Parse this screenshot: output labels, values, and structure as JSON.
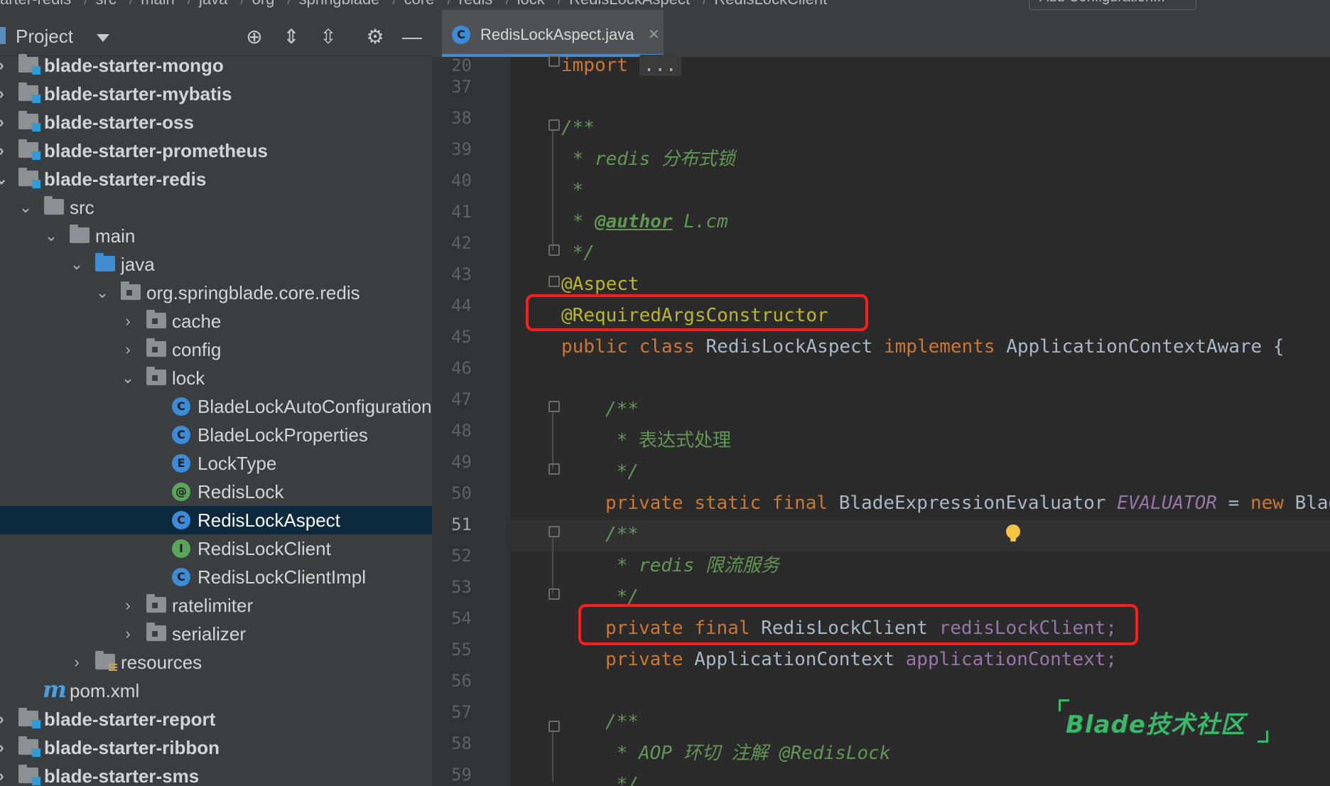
{
  "breadcrumb": [
    "arter-redis",
    "src",
    "main",
    "java",
    "org",
    "springblade",
    "core",
    "redis",
    "lock",
    "RedisLockAspect",
    "RedisLockClient"
  ],
  "toolbar": {
    "add_config": "Add Configuration..."
  },
  "project": {
    "title": "Project",
    "tree": [
      {
        "label": "blade-starter-mongo",
        "bold": true
      },
      {
        "label": "blade-starter-mybatis",
        "bold": true
      },
      {
        "label": "blade-starter-oss",
        "bold": true
      },
      {
        "label": "blade-starter-prometheus",
        "bold": true
      },
      {
        "label": "blade-starter-redis",
        "bold": true
      },
      {
        "label": "src"
      },
      {
        "label": "main"
      },
      {
        "label": "java"
      },
      {
        "label": "org.springblade.core.redis"
      },
      {
        "label": "cache"
      },
      {
        "label": "config"
      },
      {
        "label": "lock"
      },
      {
        "label": "BladeLockAutoConfiguration",
        "icon": "C"
      },
      {
        "label": "BladeLockProperties",
        "icon": "C"
      },
      {
        "label": "LockType",
        "icon": "E"
      },
      {
        "label": "RedisLock",
        "icon": "@"
      },
      {
        "label": "RedisLockAspect",
        "icon": "C",
        "selected": true
      },
      {
        "label": "RedisLockClient",
        "icon": "I"
      },
      {
        "label": "RedisLockClientImpl",
        "icon": "C"
      },
      {
        "label": "ratelimiter"
      },
      {
        "label": "serializer"
      },
      {
        "label": "resources"
      },
      {
        "label": "pom.xml",
        "icon": "m"
      },
      {
        "label": "blade-starter-report",
        "bold": true
      },
      {
        "label": "blade-starter-ribbon",
        "bold": true
      },
      {
        "label": "blade-starter-sms",
        "bold": true
      }
    ]
  },
  "editor": {
    "tab_name": "RedisLockAspect.java",
    "line_numbers": [
      "20",
      "37",
      "38",
      "39",
      "40",
      "41",
      "42",
      "43",
      "44",
      "45",
      "46",
      "47",
      "48",
      "49",
      "50",
      "51",
      "52",
      "53",
      "54",
      "55",
      "56",
      "57",
      "58",
      "59"
    ],
    "current_line": "51",
    "code": {
      "l20_kw": "import",
      "l20_dots": "...",
      "l38": "/**",
      "l39": " * redis 分布式锁",
      "l40": " *",
      "l41_pre": " * ",
      "l41_tag": "@author",
      "l41_post": " L.cm",
      "l42": " */",
      "l43": "@Aspect",
      "l44": "@RequiredArgsConstructor",
      "l45_public": "public",
      "l45_class": "class",
      "l45_name": "RedisLockAspect",
      "l45_implements": "implements",
      "l45_iface": "ApplicationContextAware {",
      "l47": "/**",
      "l48": " * 表达式处理",
      "l49": " */",
      "l50_mods": "private static final",
      "l50_type": "BladeExpressionEvaluator",
      "l50_field": "EVALUATOR",
      "l50_eq": "=",
      "l50_new": "new",
      "l50_rest": "Blade",
      "l51": "/**",
      "l52": " * redis 限流服务",
      "l53": " */",
      "l54_mods": "private final",
      "l54_type": "RedisLockClient",
      "l54_field": "redisLockClient;",
      "l55_mods": "private",
      "l55_type": "ApplicationContext",
      "l55_field": "applicationContext;",
      "l57": "/**",
      "l58": " * AOP 环切 注解 @RedisLock",
      "l59": " */"
    }
  },
  "watermark": "Blade技术社区",
  "colors": {
    "keyword": "#cc7832",
    "annotation": "#bbb529",
    "comment": "#629755",
    "field": "#9876aa",
    "highlight": "#ff1d1d"
  }
}
